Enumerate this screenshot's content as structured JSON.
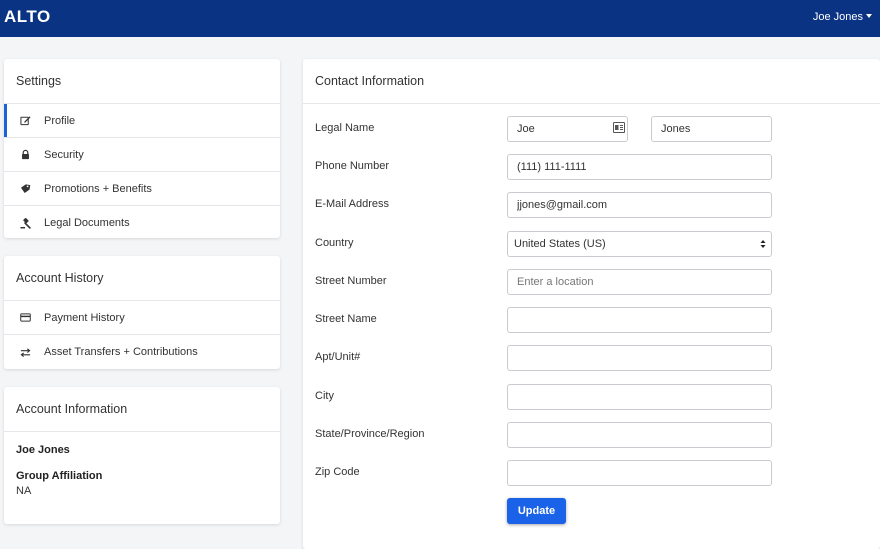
{
  "app": {
    "logo": "ALTO",
    "user_name": "Joe Jones"
  },
  "settings": {
    "title": "Settings",
    "items": [
      {
        "label": "Profile",
        "icon": "edit-icon",
        "active": true
      },
      {
        "label": "Security",
        "icon": "lock-icon"
      },
      {
        "label": "Promotions + Benefits",
        "icon": "tag-icon"
      },
      {
        "label": "Legal Documents",
        "icon": "gavel-icon"
      }
    ]
  },
  "account_history": {
    "title": "Account History",
    "items": [
      {
        "label": "Payment History",
        "icon": "credit-card-icon"
      },
      {
        "label": "Asset Transfers + Contributions",
        "icon": "exchange-icon"
      }
    ]
  },
  "account_info": {
    "title": "Account Information",
    "name": "Joe Jones",
    "affiliation_label": "Group Affiliation",
    "affiliation_value": "NA"
  },
  "contact": {
    "title": "Contact Information",
    "fields": {
      "legal_name": {
        "label": "Legal Name",
        "first": "Joe",
        "last": "Jones"
      },
      "phone": {
        "label": "Phone Number",
        "value": "(111) 111-1111"
      },
      "email": {
        "label": "E-Mail Address",
        "value": "jjones@gmail.com"
      },
      "country": {
        "label": "Country",
        "value": "United States (US)"
      },
      "street_number": {
        "label": "Street Number",
        "value": "",
        "placeholder": "Enter a location"
      },
      "street_name": {
        "label": "Street Name",
        "value": ""
      },
      "apt": {
        "label": "Apt/Unit#",
        "value": ""
      },
      "city": {
        "label": "City",
        "value": ""
      },
      "state": {
        "label": "State/Province/Region",
        "value": ""
      },
      "zip": {
        "label": "Zip Code",
        "value": ""
      }
    },
    "update_label": "Update"
  },
  "colors": {
    "navbar": "#0a3384",
    "accent": "#1a62e8",
    "active_bar": "#1a62d6"
  }
}
